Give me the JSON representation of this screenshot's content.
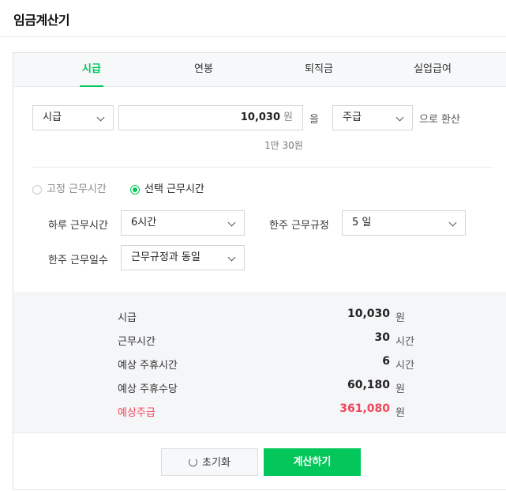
{
  "header": {
    "title": "임금계산기"
  },
  "tabs": [
    {
      "label": "시급",
      "active": true
    },
    {
      "label": "연봉",
      "active": false
    },
    {
      "label": "퇴직금",
      "active": false
    },
    {
      "label": "실업급여",
      "active": false
    }
  ],
  "conversion": {
    "pay_type": "시급",
    "amount": "10,030",
    "amount_unit": "원",
    "particle": "을",
    "target_type": "주급",
    "suffix": "으로 환산",
    "amount_korean": "1만 30원"
  },
  "work_mode": {
    "fixed_label": "고정 근무시간",
    "fixed_selected": false,
    "select_label": "선택 근무시간",
    "select_selected": true
  },
  "fields": {
    "daily_hours_label": "하루 근무시간",
    "daily_hours_value": "6시간",
    "weekly_rule_label": "한주 근무규정",
    "weekly_rule_value": "5 일",
    "weekly_days_label": "한주 근무일수",
    "weekly_days_value": "근무규정과 동일"
  },
  "results": [
    {
      "label": "시급",
      "value": "10,030",
      "unit": "원"
    },
    {
      "label": "근무시간",
      "value": "30",
      "unit": "시간"
    },
    {
      "label": "예상 주휴시간",
      "value": "6",
      "unit": "시간"
    },
    {
      "label": "예상 주휴수당",
      "value": "60,180",
      "unit": "원"
    },
    {
      "label": "예상주급",
      "value": "361,080",
      "unit": "원"
    }
  ],
  "buttons": {
    "reset": "초기화",
    "calculate": "계산하기"
  },
  "colors": {
    "accent": "#03c75a",
    "total": "#f0465a"
  }
}
